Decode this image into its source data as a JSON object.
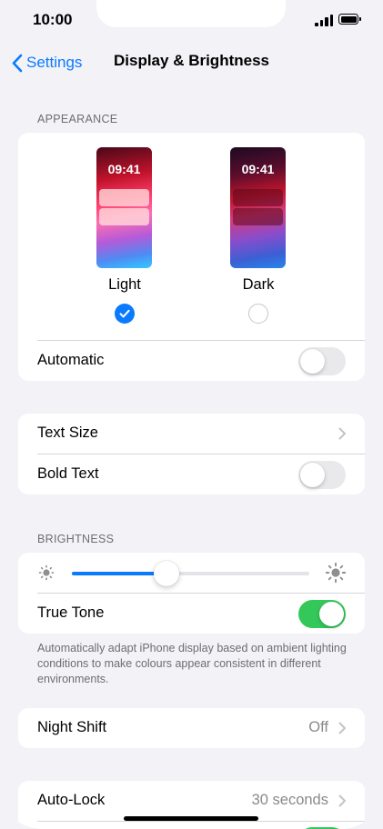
{
  "status_bar": {
    "time": "10:00"
  },
  "nav": {
    "back_label": "Settings",
    "title": "Display & Brightness"
  },
  "appearance": {
    "section_label": "APPEARANCE",
    "light": {
      "preview_time": "09:41",
      "label": "Light",
      "selected": true
    },
    "dark": {
      "preview_time": "09:41",
      "label": "Dark",
      "selected": false
    },
    "automatic": {
      "label": "Automatic",
      "on": false
    }
  },
  "text_group": {
    "text_size": {
      "label": "Text Size"
    },
    "bold_text": {
      "label": "Bold Text",
      "on": false
    }
  },
  "brightness": {
    "section_label": "BRIGHTNESS",
    "level_fraction": 0.4,
    "true_tone": {
      "label": "True Tone",
      "on": true
    },
    "footnote": "Automatically adapt iPhone display based on ambient lighting conditions to make colours appear consistent in different environments."
  },
  "night_shift": {
    "label": "Night Shift",
    "value": "Off"
  },
  "auto_lock": {
    "label": "Auto-Lock",
    "value": "30 seconds"
  },
  "colors": {
    "accent": "#0a7aff",
    "toggle_on": "#34c759",
    "toggle_off": "#e9e9eb",
    "background": "#f2f2f7"
  },
  "icons": {
    "back": "chevron-left-icon",
    "chevron": "chevron-right-icon",
    "check": "checkmark-icon",
    "sun_small": "sun-small-icon",
    "sun_large": "sun-large-icon"
  }
}
